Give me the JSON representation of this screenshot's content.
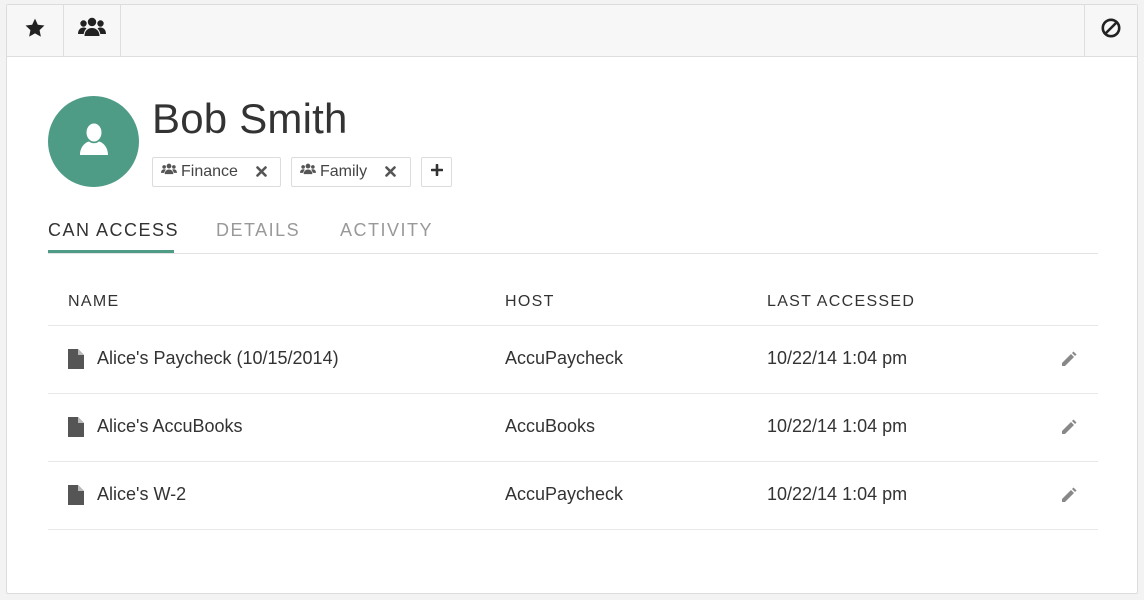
{
  "toolbar": {
    "star_icon": "star-icon",
    "group_icon": "users-icon",
    "block_icon": "block-icon"
  },
  "profile": {
    "name": "Bob Smith",
    "avatar_color": "#4e9b86",
    "groups": [
      {
        "label": "Finance"
      },
      {
        "label": "Family"
      }
    ],
    "add_icon": "plus-icon",
    "remove_icon": "close-icon"
  },
  "tabs": [
    {
      "label": "CAN ACCESS",
      "active": true
    },
    {
      "label": "DETAILS",
      "active": false
    },
    {
      "label": "ACTIVITY",
      "active": false
    }
  ],
  "table": {
    "columns": [
      "NAME",
      "HOST",
      "LAST ACCESSED"
    ],
    "rows": [
      {
        "name": "Alice's Paycheck (10/15/2014)",
        "host": "AccuPaycheck",
        "last_accessed": "10/22/14 1:04 pm"
      },
      {
        "name": "Alice's AccuBooks",
        "host": "AccuBooks",
        "last_accessed": "10/22/14 1:04 pm"
      },
      {
        "name": "Alice's W-2",
        "host": "AccuPaycheck",
        "last_accessed": "10/22/14 1:04 pm"
      }
    ]
  },
  "colors": {
    "accent": "#4e9b86",
    "text": "#333333",
    "muted": "#999999"
  }
}
